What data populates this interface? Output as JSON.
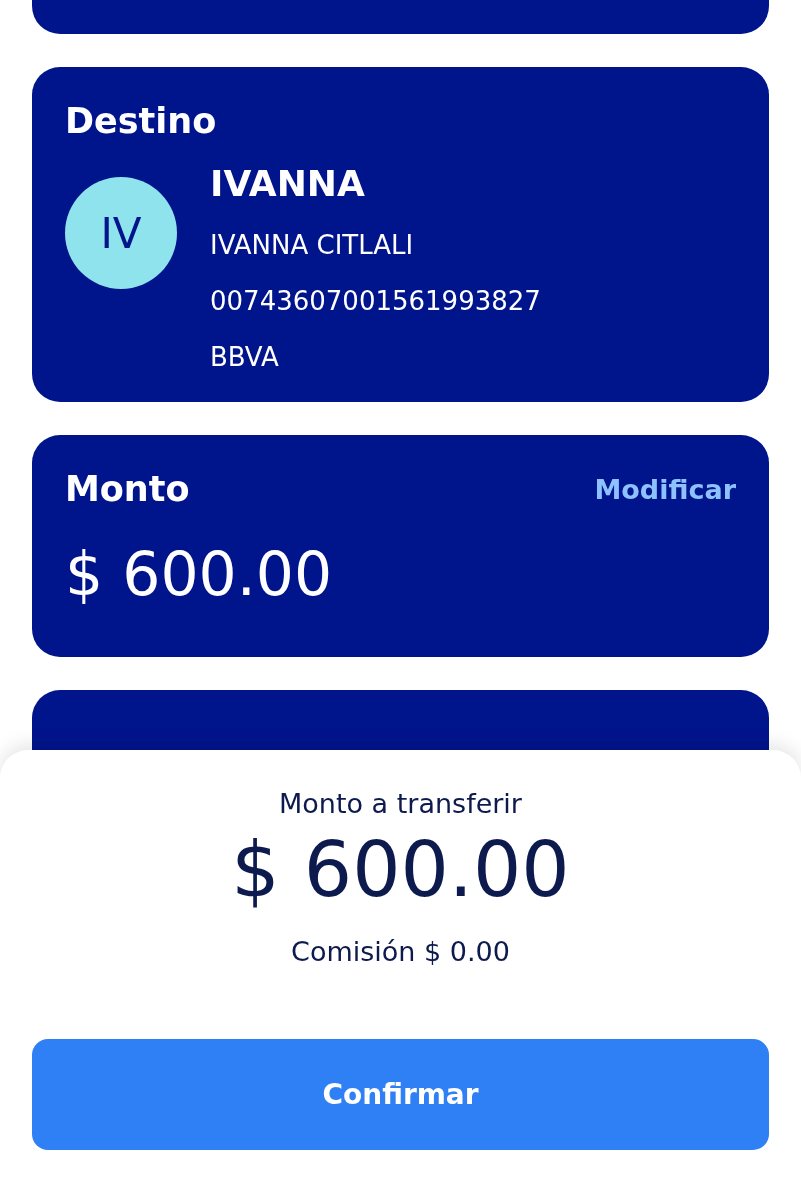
{
  "destination": {
    "title": "Destino",
    "avatar_initials": "IV",
    "alias": "IVANNA",
    "name": "IVANNA CITLALI",
    "account": "00743607001561993827",
    "bank": "BBVA"
  },
  "amount": {
    "title": "Monto",
    "action": "Modificar",
    "value": "$ 600.00"
  },
  "summary": {
    "label": "Monto a transferir",
    "value": "$ 600.00",
    "fee": "Comisión $ 0.00",
    "button": "Confirmar"
  }
}
